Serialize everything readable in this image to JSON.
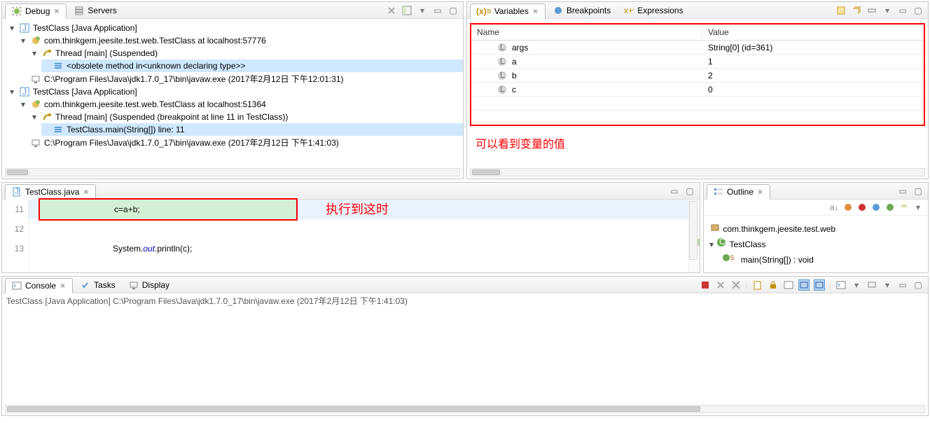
{
  "debugPane": {
    "tabs": [
      {
        "label": "Debug",
        "active": true
      },
      {
        "label": "Servers",
        "active": false
      }
    ],
    "tree": [
      {
        "indent": 0,
        "twisty": "▾",
        "icon": "java-app",
        "text": "TestClass [Java Application]"
      },
      {
        "indent": 1,
        "twisty": "▾",
        "icon": "vm",
        "text": "com.thinkgem.jeesite.test.web.TestClass at localhost:57776"
      },
      {
        "indent": 2,
        "twisty": "▾",
        "icon": "thread",
        "text": "Thread [main] (Suspended)"
      },
      {
        "indent": 3,
        "twisty": "",
        "icon": "frame",
        "text": "<obsolete method in<unknown declaring type>>",
        "sel": true
      },
      {
        "indent": 1,
        "twisty": "",
        "icon": "process",
        "text": "C:\\Program Files\\Java\\jdk1.7.0_17\\bin\\javaw.exe (2017年2月12日 下午12:01:31)"
      },
      {
        "indent": 0,
        "twisty": "▾",
        "icon": "java-app",
        "text": "TestClass [Java Application]"
      },
      {
        "indent": 1,
        "twisty": "▾",
        "icon": "vm",
        "text": "com.thinkgem.jeesite.test.web.TestClass at localhost:51364"
      },
      {
        "indent": 2,
        "twisty": "▾",
        "icon": "thread",
        "text": "Thread [main] (Suspended (breakpoint at line 11 in TestClass))"
      },
      {
        "indent": 3,
        "twisty": "",
        "icon": "frame",
        "text": "TestClass.main(String[]) line: 11",
        "sel": true
      },
      {
        "indent": 1,
        "twisty": "",
        "icon": "process",
        "text": "C:\\Program Files\\Java\\jdk1.7.0_17\\bin\\javaw.exe (2017年2月12日 下午1:41:03)"
      }
    ]
  },
  "varsPane": {
    "tabs": [
      {
        "label": "Variables",
        "active": true,
        "prefix": "(x)="
      },
      {
        "label": "Breakpoints",
        "active": false,
        "iconColor": "#3a7bd5"
      },
      {
        "label": "Expressions",
        "active": false
      }
    ],
    "headers": {
      "name": "Name",
      "value": "Value"
    },
    "rows": [
      {
        "name": "args",
        "value": "String[0]  (id=361)"
      },
      {
        "name": "a",
        "value": "1"
      },
      {
        "name": "b",
        "value": "2"
      },
      {
        "name": "c",
        "value": "0"
      }
    ],
    "note": "可以看到变量的值"
  },
  "editor": {
    "tab": "TestClass.java",
    "lines": [
      {
        "num": "11",
        "current": true,
        "code": "c=a+b;"
      },
      {
        "num": "12",
        "current": false,
        "code": ""
      },
      {
        "num": "13",
        "current": false,
        "code_html": true,
        "plain": "System.",
        "field": "out",
        "rest": ".println(c);"
      }
    ],
    "exec_note": "执行到这时"
  },
  "outline": {
    "tab": "Outline",
    "package": "com.thinkgem.jeesite.test.web",
    "class": "TestClass",
    "method": "main(String[]) : void"
  },
  "bottom": {
    "tabs": [
      {
        "label": "Console",
        "active": true
      },
      {
        "label": "Tasks",
        "active": false
      },
      {
        "label": "Display",
        "active": false
      }
    ],
    "status": "TestClass [Java Application] C:\\Program Files\\Java\\jdk1.7.0_17\\bin\\javaw.exe (2017年2月12日 下午1:41:03)"
  }
}
